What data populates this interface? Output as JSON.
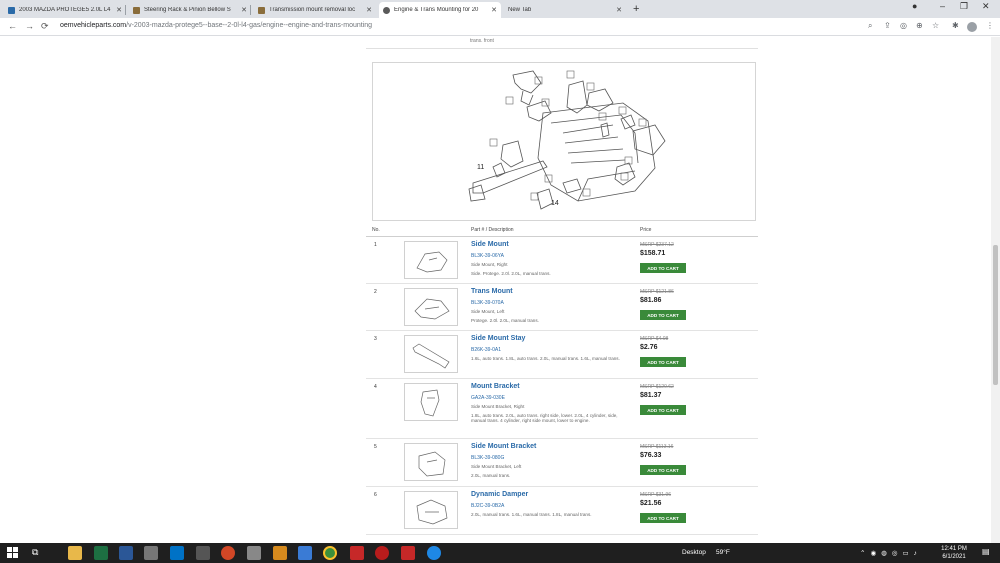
{
  "browser": {
    "tabs": [
      {
        "title": "2003 MAZDA PROTEGE5 2.0L L4",
        "favicon": "#2a6aa8"
      },
      {
        "title": "Steering Rack & Pinion Bellow S",
        "favicon": "#8a6d3b"
      },
      {
        "title": "Transmission mount removal loc",
        "favicon": "#8a6d3b"
      },
      {
        "title": "Engine & Trans Mounting for 20",
        "favicon": "#5a5a5a"
      },
      {
        "title": "New Tab",
        "favicon": ""
      }
    ],
    "new_tab_symbol": "+",
    "url_host": "oemvehicleparts.com",
    "url_path": "/v-2003-mazda-protege5--base--2-0l-l4-gas/engine--engine-and-trans-mounting"
  },
  "page": {
    "prev_text": "trans. front",
    "table_headers": {
      "no": "No.",
      "part": "Part # / Description",
      "price": "Price"
    },
    "parts": [
      {
        "no": "1",
        "name": "Side Mount",
        "number": "BL3K-39-06YA",
        "desc": "Side Mount, Right",
        "note": "Side. Protege. 2.0l. 2.0L, manual trans.",
        "msrp": "MSRP $237.12",
        "price": "$158.71",
        "cart": "ADD TO CART"
      },
      {
        "no": "2",
        "name": "Trans Mount",
        "number": "BL3K-39-070A",
        "desc": "Side Mount, Left",
        "note": "Protege. 2.0l. 2.0L, manual trans.",
        "msrp": "MSRP $121.86",
        "price": "$81.86",
        "cart": "ADD TO CART"
      },
      {
        "no": "3",
        "name": "Side Mount Stay",
        "number": "B26K-39-0A1",
        "desc": "1.6L, auto trans. 1.8L, auto trans. 2.0L, manual trans. 1.6L, manual trans.",
        "note": "",
        "msrp": "MSRP $4.08",
        "price": "$2.76",
        "cart": "ADD TO CART"
      },
      {
        "no": "4",
        "name": "Mount Bracket",
        "number": "GA2A-39-030E",
        "desc": "Side Mount Bracket, Right",
        "note": "1.8L, auto trans. 2.0L, auto trans. right side, lower. 2.0L, 4 cylinder, side, manual trans. 4 cylinder, right side mount, lower to engine.",
        "msrp": "MSRP $120.62",
        "price": "$81.37",
        "cart": "ADD TO CART"
      },
      {
        "no": "5",
        "name": "Side Mount Bracket",
        "number": "BL3K-39-080G",
        "desc": "Side Mount Bracket, Left",
        "note": "2.0L, manual trans.",
        "msrp": "MSRP $113.16",
        "price": "$76.33",
        "cart": "ADD TO CART"
      },
      {
        "no": "6",
        "name": "Dynamic Damper",
        "number": "BJ2C-39-0B2A",
        "desc": "2.0L, manual trans. 1.6L, manual trans. 1.8L, manual trans.",
        "note": "",
        "msrp": "MSRP $31.96",
        "price": "$21.56",
        "cart": "ADD TO CART"
      }
    ],
    "diagram_callouts": [
      "11",
      "14"
    ]
  },
  "taskbar": {
    "desktop_label": "Desktop",
    "weather": "59°F",
    "time": "12:41 PM",
    "date": "6/1/2021"
  }
}
